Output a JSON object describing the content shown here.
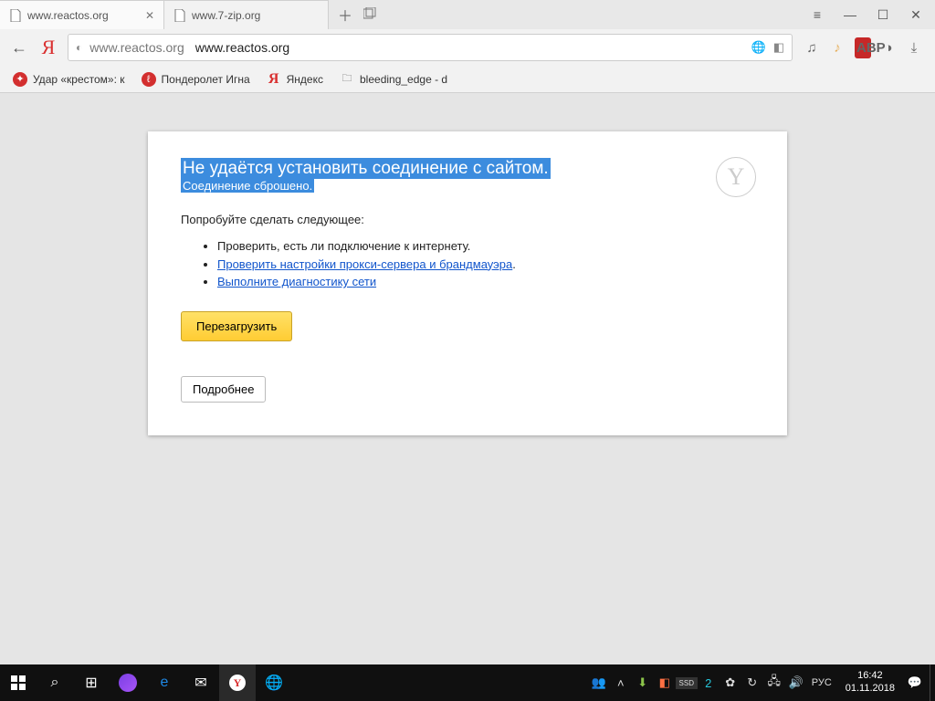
{
  "tabs": [
    {
      "title": "www.reactos.org"
    },
    {
      "title": "www.7-zip.org"
    }
  ],
  "addressBar": {
    "display": "www.reactos.org",
    "main": "www.reactos.org"
  },
  "bookmarks": [
    {
      "label": "Удар «крестом»: к"
    },
    {
      "label": "Пондеролет Игна"
    },
    {
      "label": "Яндекс"
    },
    {
      "label": "bleeding_edge - d"
    }
  ],
  "error": {
    "title": "Не удаётся установить соединение с сайтом.",
    "subtitle": "Соединение сброшено.",
    "tryLabel": "Попробуйте сделать следующее:",
    "items": {
      "check": "Проверить, есть ли подключение к интернету.",
      "proxy": "Проверить настройки прокси-сервера и брандмауэра",
      "diag": "Выполните диагностику сети"
    },
    "reload": "Перезагрузить",
    "details": "Подробнее"
  },
  "extensions": {
    "abp": "ABP"
  },
  "taskbar": {
    "lang": "РУС",
    "time": "16:42",
    "date": "01.11.2018"
  }
}
